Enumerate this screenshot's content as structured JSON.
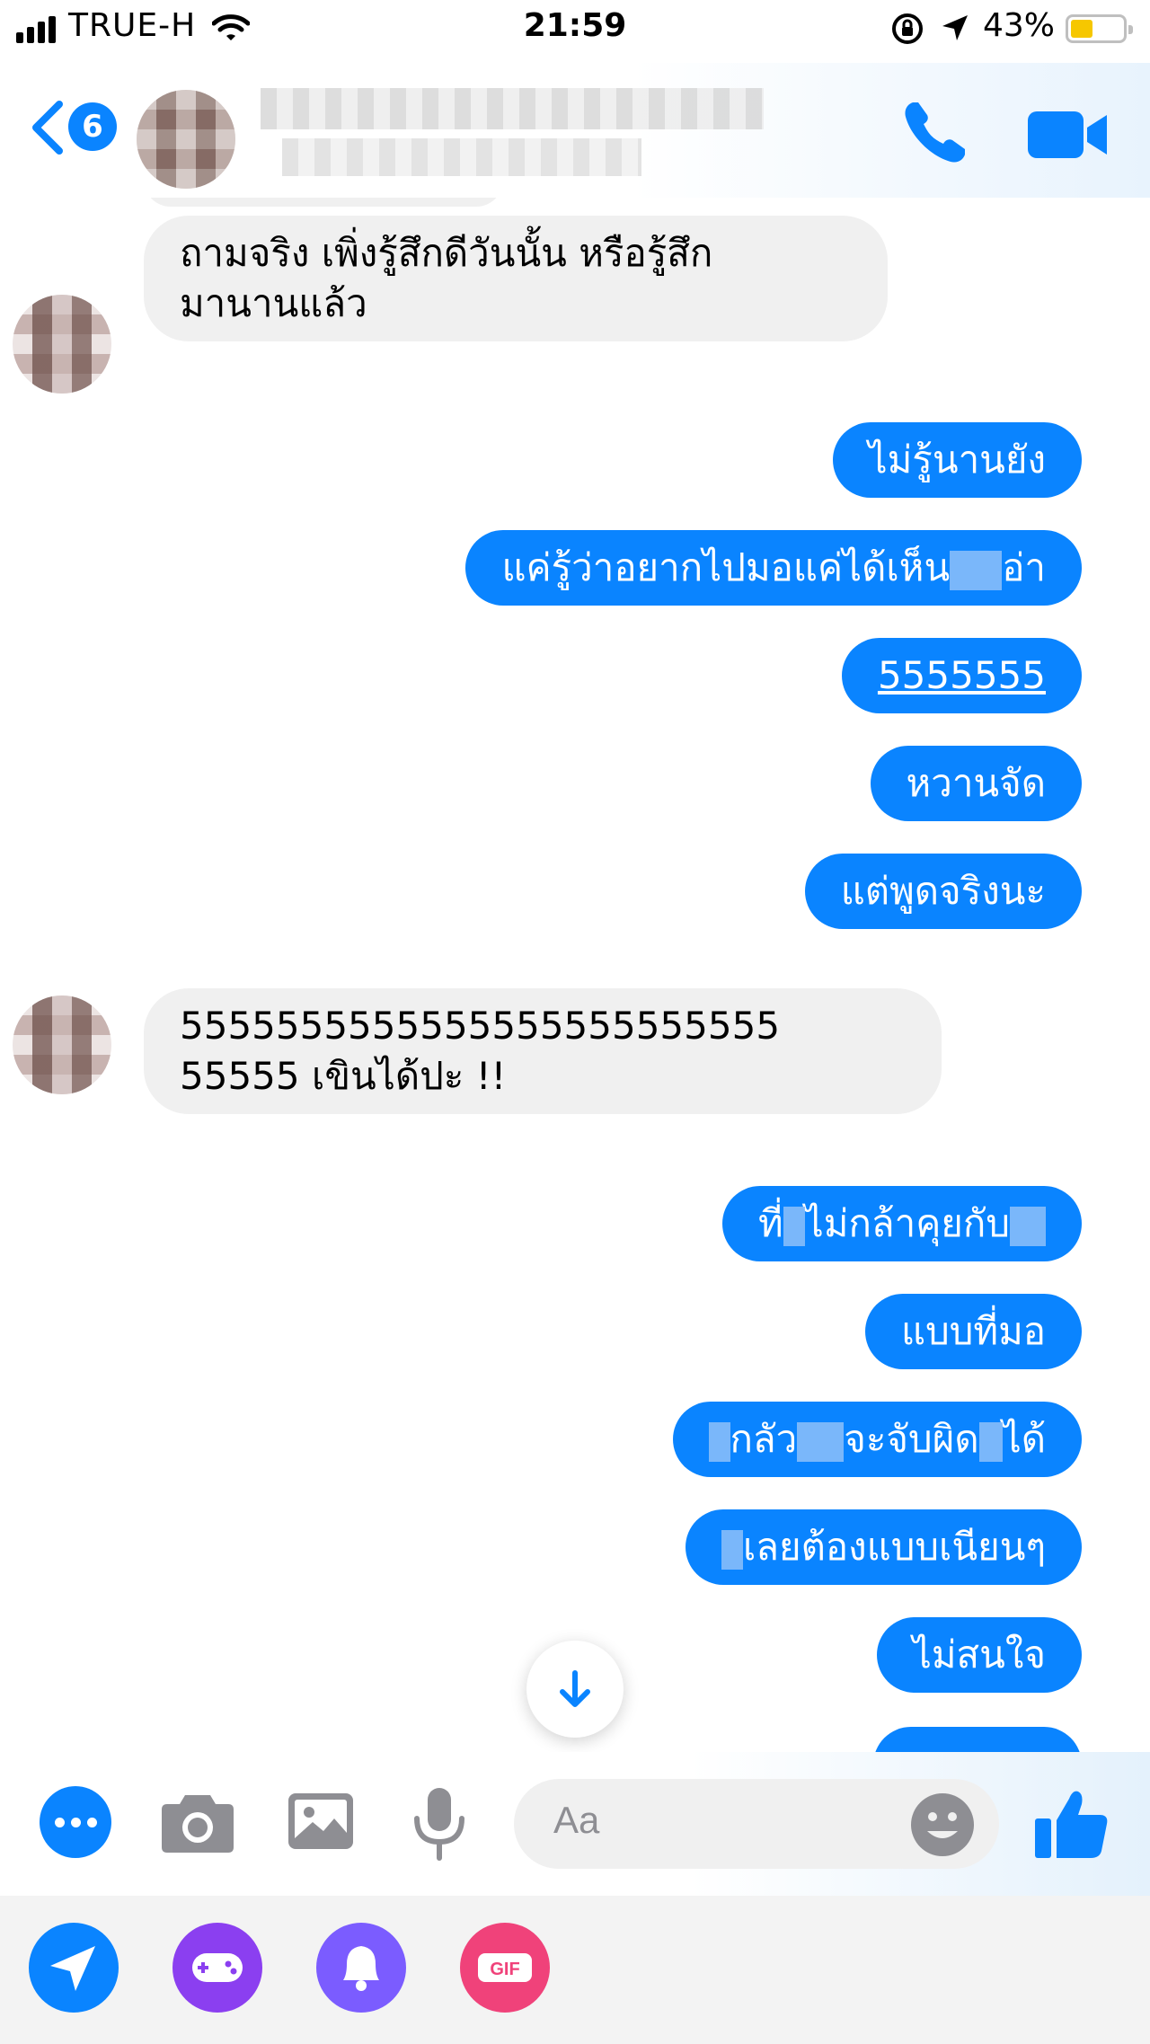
{
  "status_bar": {
    "carrier": "TRUE-H",
    "time": "21:59",
    "battery_percent": "43%",
    "battery_level": 0.43
  },
  "header": {
    "unread_count": "6"
  },
  "messages": [
    {
      "direction": "incoming",
      "lines": [
        "ถามจริง เพิ่งรู้สึกดีวันนั้น หรือรู้สึก",
        "มานานแล้ว"
      ]
    },
    {
      "direction": "outgoing",
      "text": "ไม่รู้นานยัง"
    },
    {
      "direction": "outgoing",
      "text": "แค่รู้ว่าอยากไปมอแค่ได้เห็น",
      "text_after": "อ่า"
    },
    {
      "direction": "outgoing",
      "text": "5555555"
    },
    {
      "direction": "outgoing",
      "text": "หวานจัด"
    },
    {
      "direction": "outgoing",
      "text": "แต่พูดจริงนะ"
    },
    {
      "direction": "incoming",
      "lines": [
        "5555555555555555555555555",
        "55555 เขินได้ปะ !!"
      ]
    },
    {
      "direction": "outgoing",
      "text": "ที่",
      "text_after": "ไม่กล้าคุยกับ"
    },
    {
      "direction": "outgoing",
      "text": "แบบที่มอ"
    },
    {
      "direction": "outgoing",
      "text": "กลัว",
      "text_mid": "จะจับผิด",
      "text_after": "ได้"
    },
    {
      "direction": "outgoing",
      "text": "เลยต้องแบบเนียนๆ"
    },
    {
      "direction": "outgoing",
      "text": "ไม่สนใจ"
    }
  ],
  "composer": {
    "placeholder": "Aa"
  },
  "tray": {
    "gif_label": "GIF"
  },
  "colors": {
    "accent": "#0a84ff",
    "incoming_bubble": "#f0f0f0",
    "games": "#8b3ff0",
    "notify": "#7b5cff",
    "gif": "#f0427a"
  },
  "icons": [
    "signal-icon",
    "wifi-icon",
    "orientation-lock-icon",
    "location-icon",
    "battery-icon",
    "back-chevron-icon",
    "phone-icon",
    "video-camera-icon",
    "more-icon",
    "camera-icon",
    "image-icon",
    "microphone-icon",
    "emoji-icon",
    "thumbs-up-icon",
    "send-icon",
    "game-controller-icon",
    "bell-icon",
    "gif-icon",
    "arrow-down-icon"
  ]
}
